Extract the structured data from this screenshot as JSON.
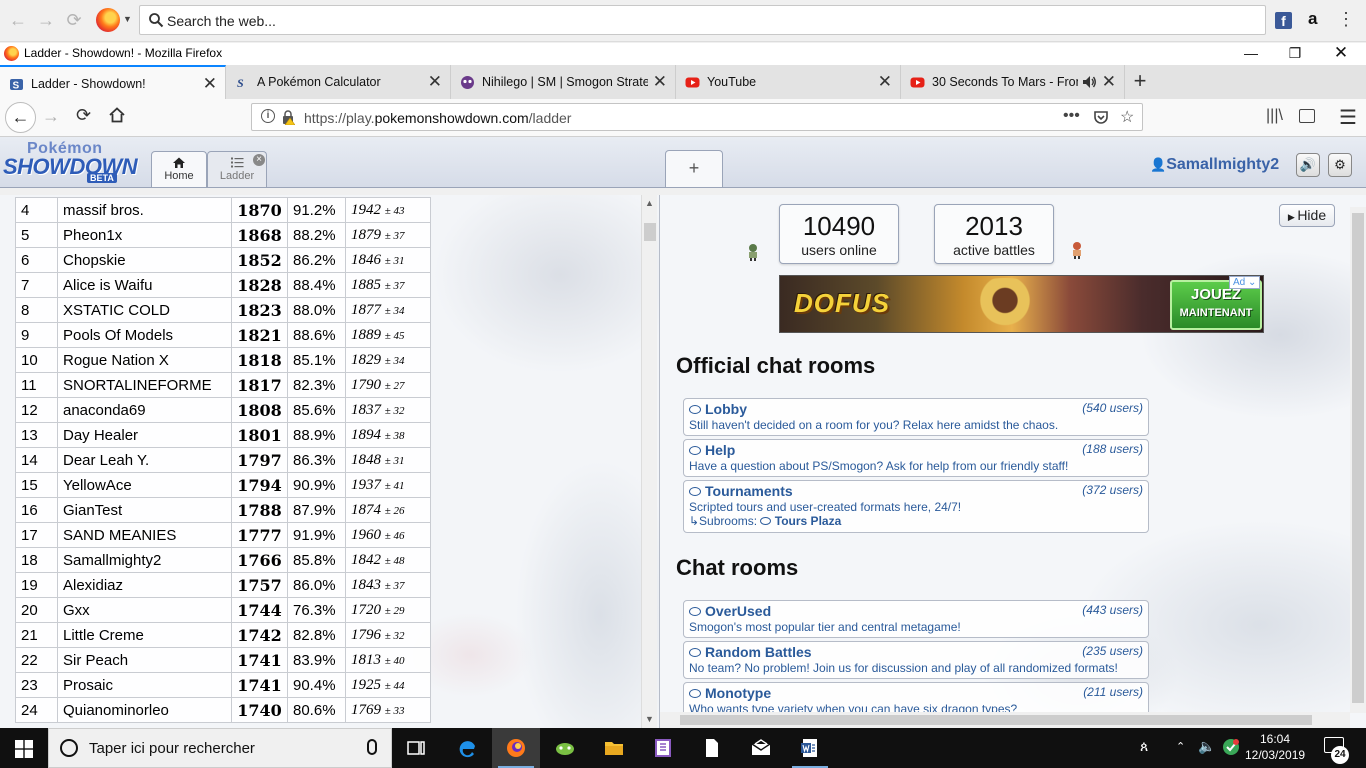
{
  "browser": {
    "web_search_placeholder": "Search the web...",
    "window_title": "Ladder - Showdown! - Mozilla Firefox",
    "tabs": [
      {
        "label": "Ladder - Showdown!",
        "icon": "showdown-favicon"
      },
      {
        "label": "A Pokémon Calculator",
        "icon": "calc-favicon"
      },
      {
        "label": "Nihilego | SM | Smogon Strateg",
        "icon": "smogon-favicon"
      },
      {
        "label": "YouTube",
        "icon": "youtube-favicon"
      },
      {
        "label": "30 Seconds To Mars - From",
        "icon": "youtube-favicon"
      }
    ],
    "url_prefix": "https://play.",
    "url_host": "pokemonshowdown.com",
    "url_path": "/ladder",
    "amazon_glyph": "a",
    "facebook_glyph": "f"
  },
  "showdown": {
    "logo_top": "Pokémon",
    "logo_main": "SHOWDOWN",
    "logo_badge": "BETA",
    "tab_home": "Home",
    "tab_ladder": "Ladder",
    "new_tab_symbol": "+",
    "username": "Samallmighty2",
    "users_online_count": "10490",
    "users_online_label": "users online",
    "active_battles_count": "2013",
    "active_battles_label": "active battles",
    "hide_label": "Hide",
    "ad": {
      "brand": "DOFUS",
      "cta_line1": "JOUEZ",
      "cta_line2": "MAINTENANT",
      "tag": "Ad"
    },
    "official_heading": "Official chat rooms",
    "chat_heading": "Chat rooms",
    "official_rooms": [
      {
        "name": "Lobby",
        "users": "(540 users)",
        "desc": "Still haven't decided on a room for you? Relax here amidst the chaos."
      },
      {
        "name": "Help",
        "users": "(188 users)",
        "desc": "Have a question about PS/Smogon? Ask for help from our friendly staff!"
      },
      {
        "name": "Tournaments",
        "users": "(372 users)",
        "desc": "Scripted tours and user-created formats here, 24/7!",
        "subrooms_label": "↳Subrooms:",
        "subroom": "Tours Plaza"
      }
    ],
    "chat_rooms": [
      {
        "name": "OverUsed",
        "users": "(443 users)",
        "desc": "Smogon's most popular tier and central metagame!"
      },
      {
        "name": "Random Battles",
        "users": "(235 users)",
        "desc": "No team? No problem! Join us for discussion and play of all randomized formats!"
      },
      {
        "name": "Monotype",
        "users": "(211 users)",
        "desc": "Who wants type variety when you can have six dragon types?"
      }
    ]
  },
  "ladder": {
    "rows": [
      {
        "rank": "4",
        "name": "massif bros.",
        "elo": "1870",
        "gxe": "91.2%",
        "glicko": "1942",
        "dev": "± 43"
      },
      {
        "rank": "5",
        "name": "Pheon1x",
        "elo": "1868",
        "gxe": "88.2%",
        "glicko": "1879",
        "dev": "± 37"
      },
      {
        "rank": "6",
        "name": "Chopskie",
        "elo": "1852",
        "gxe": "86.2%",
        "glicko": "1846",
        "dev": "± 31"
      },
      {
        "rank": "7",
        "name": "Alice is Waifu",
        "elo": "1828",
        "gxe": "88.4%",
        "glicko": "1885",
        "dev": "± 37"
      },
      {
        "rank": "8",
        "name": "XSTATIC COLD",
        "elo": "1823",
        "gxe": "88.0%",
        "glicko": "1877",
        "dev": "± 34"
      },
      {
        "rank": "9",
        "name": "Pools Of Models",
        "elo": "1821",
        "gxe": "88.6%",
        "glicko": "1889",
        "dev": "± 45"
      },
      {
        "rank": "10",
        "name": "Rogue Nation X",
        "elo": "1818",
        "gxe": "85.1%",
        "glicko": "1829",
        "dev": "± 34"
      },
      {
        "rank": "11",
        "name": "SNORTALINEFORME",
        "elo": "1817",
        "gxe": "82.3%",
        "glicko": "1790",
        "dev": "± 27"
      },
      {
        "rank": "12",
        "name": "anaconda69",
        "elo": "1808",
        "gxe": "85.6%",
        "glicko": "1837",
        "dev": "± 32"
      },
      {
        "rank": "13",
        "name": "Day Healer",
        "elo": "1801",
        "gxe": "88.9%",
        "glicko": "1894",
        "dev": "± 38"
      },
      {
        "rank": "14",
        "name": "Dear Leah Y.",
        "elo": "1797",
        "gxe": "86.3%",
        "glicko": "1848",
        "dev": "± 31"
      },
      {
        "rank": "15",
        "name": "YellowAce",
        "elo": "1794",
        "gxe": "90.9%",
        "glicko": "1937",
        "dev": "± 41"
      },
      {
        "rank": "16",
        "name": "GianTest",
        "elo": "1788",
        "gxe": "87.9%",
        "glicko": "1874",
        "dev": "± 26"
      },
      {
        "rank": "17",
        "name": "SAND MEANIES",
        "elo": "1777",
        "gxe": "91.9%",
        "glicko": "1960",
        "dev": "± 46"
      },
      {
        "rank": "18",
        "name": "Samallmighty2",
        "elo": "1766",
        "gxe": "85.8%",
        "glicko": "1842",
        "dev": "± 48"
      },
      {
        "rank": "19",
        "name": "Alexidiaz",
        "elo": "1757",
        "gxe": "86.0%",
        "glicko": "1843",
        "dev": "± 37"
      },
      {
        "rank": "20",
        "name": "Gxx",
        "elo": "1744",
        "gxe": "76.3%",
        "glicko": "1720",
        "dev": "± 29"
      },
      {
        "rank": "21",
        "name": "Little Creme",
        "elo": "1742",
        "gxe": "82.8%",
        "glicko": "1796",
        "dev": "± 32"
      },
      {
        "rank": "22",
        "name": "Sir Peach",
        "elo": "1741",
        "gxe": "83.9%",
        "glicko": "1813",
        "dev": "± 40"
      },
      {
        "rank": "23",
        "name": "Prosaic",
        "elo": "1741",
        "gxe": "90.4%",
        "glicko": "1925",
        "dev": "± 44"
      },
      {
        "rank": "24",
        "name": "Quianominorleo",
        "elo": "1740",
        "gxe": "80.6%",
        "glicko": "1769",
        "dev": "± 33"
      }
    ]
  },
  "taskbar": {
    "search_placeholder": "Taper ici pour rechercher",
    "time": "16:04",
    "date": "12/03/2019",
    "notification_count": "24"
  },
  "colors": {
    "accent_blue": "#0a84ff",
    "showdown_link": "#2a5a9a",
    "username": "#3a63a8"
  }
}
